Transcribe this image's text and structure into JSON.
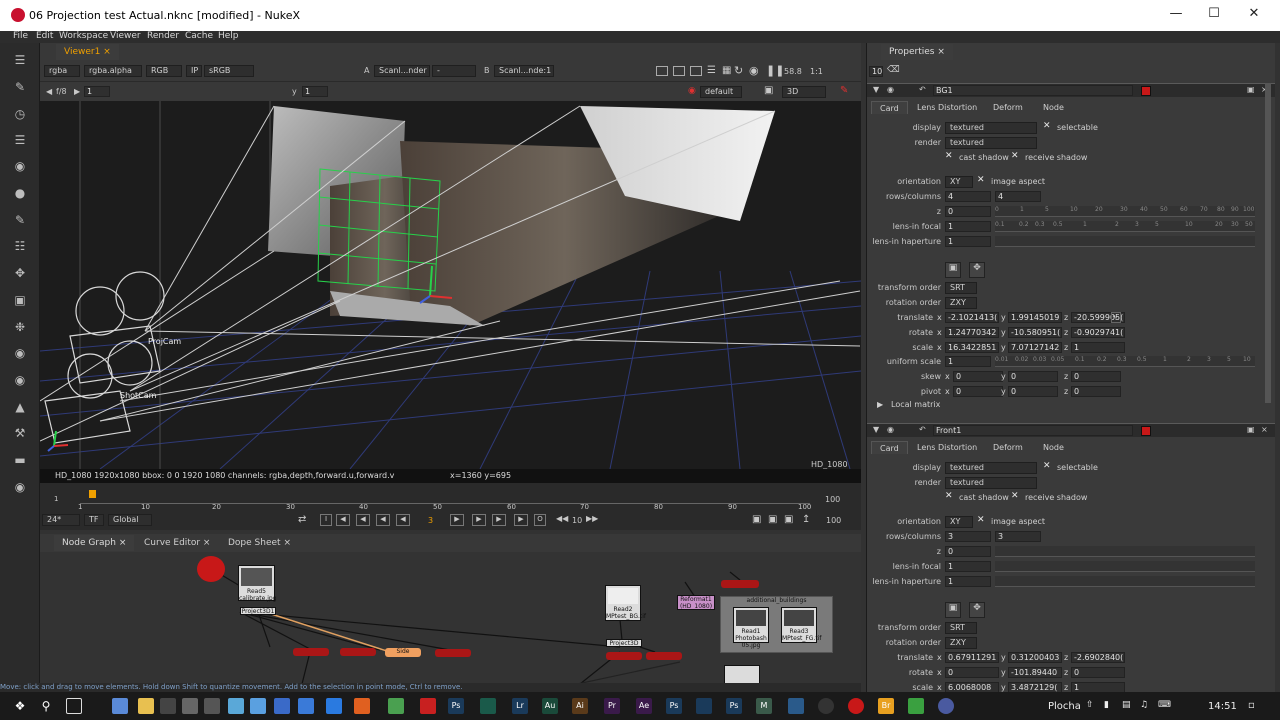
{
  "window": {
    "title": "06 Projection test Actual.nknc [modified] - NukeX"
  },
  "menu": [
    "File",
    "Edit",
    "Workspace",
    "Viewer",
    "Render",
    "Cache",
    "Help"
  ],
  "viewer": {
    "tab_label": "Viewer1",
    "channels": "rgba",
    "alpha": "rgba.alpha",
    "colorspace": "RGB",
    "ip_label": "IP",
    "lut": "sRGB",
    "input_a_label": "A",
    "input_a": "Scanl...nder",
    "input_a_op": "-",
    "input_b_label": "B",
    "input_b": "Scanl...nde:1",
    "gain": "58.8",
    "zoom": "1:1",
    "frame_label": "f/8",
    "frame_val": "1",
    "y_label": "y",
    "y_val": "1",
    "camera": "default",
    "view_mode": "3D",
    "label_projcam": "ProjCam",
    "label_shotcam": "ShotCam",
    "format_badge": "HD_1080",
    "info_text": "HD_1080 1920x1080  bbox: 0 0 1920 1080 channels: rgba,depth,forward.u,forward.v",
    "coords_text": "x=1360 y=695"
  },
  "timeline": {
    "ticks": [
      "1",
      "10",
      "20",
      "30",
      "40",
      "50",
      "60",
      "70",
      "80",
      "90",
      "100"
    ],
    "start": "1",
    "end": "100",
    "end_right": "100",
    "fps": "24*",
    "tf": "TF",
    "scope": "Global",
    "current_frame": "3",
    "step": "10",
    "out_frame": "100"
  },
  "bottom_tabs": [
    "Node Graph",
    "Curve Editor",
    "Dope Sheet"
  ],
  "nodes": {
    "read5": "Read5",
    "read5_file": "calibrate.jpg",
    "project3d1": "Project3D1",
    "side": "Side",
    "read2": "Read2",
    "read2_file": "MPtest_BG.tif",
    "project3d": "Project3D",
    "reformat": "Reformat1",
    "reformat_sub": "(HD_1080)",
    "backdrop": "additional_buildings",
    "read1": "Read1",
    "read1_file": "Photobash 05.jpg",
    "read3": "Read3",
    "read3_file": "MPtest_FG.tif"
  },
  "status_text": "Move: click and drag to move elements. Hold down Shift to quantize movement. Add to the selection in point mode, Ctrl to remove.",
  "properties": {
    "tab_label": "Properties",
    "max_panels": "10",
    "panels": [
      {
        "name": "BG1",
        "tabs": [
          "Card",
          "Lens Distortion",
          "Deform",
          "Node"
        ],
        "display_label": "display",
        "display": "textured",
        "selectable": "selectable",
        "render_label": "render",
        "render": "textured",
        "cast_shadow": "cast shadow",
        "receive_shadow": "receive shadow",
        "orientation_label": "orientation",
        "orientation": "XY",
        "image_aspect": "image aspect",
        "rows_label": "rows/columns",
        "rows": "4",
        "columns": "4",
        "z_label": "z",
        "z": "0",
        "focal_label": "lens-in focal",
        "focal": "1",
        "haperture_label": "lens-in haperture",
        "haperture": "1",
        "transform_order_label": "transform order",
        "transform_order": "SRT",
        "rotation_order_label": "rotation order",
        "rotation_order": "ZXY",
        "translate_label": "translate",
        "translate": [
          "-2.1021413(",
          "1.99145019",
          "-20.599905("
        ],
        "rotate_label": "rotate",
        "rotate": [
          "1.24770342",
          "-10.580951(",
          "-0.9029741("
        ],
        "scale_label": "scale",
        "scale": [
          "16.3422851",
          "7.07127142",
          "1"
        ],
        "uniform_scale_label": "uniform scale",
        "uniform_scale": "1",
        "skew_label": "skew",
        "skew": [
          "0",
          "0",
          "0"
        ],
        "pivot_label": "pivot",
        "pivot": [
          "0",
          "0",
          "0"
        ],
        "local_matrix": "Local matrix"
      },
      {
        "name": "Front1",
        "tabs": [
          "Card",
          "Lens Distortion",
          "Deform",
          "Node"
        ],
        "display_label": "display",
        "display": "textured",
        "selectable": "selectable",
        "render_label": "render",
        "render": "textured",
        "cast_shadow": "cast shadow",
        "receive_shadow": "receive shadow",
        "orientation_label": "orientation",
        "orientation": "XY",
        "image_aspect": "image aspect",
        "rows_label": "rows/columns",
        "rows": "3",
        "columns": "3",
        "z_label": "z",
        "z": "0",
        "focal_label": "lens-in focal",
        "focal": "1",
        "haperture_label": "lens-in haperture",
        "haperture": "1",
        "transform_order_label": "transform order",
        "transform_order": "SRT",
        "rotation_order_label": "rotation order",
        "rotation_order": "ZXY",
        "translate_label": "translate",
        "translate": [
          "0.67911291",
          "0.31200403",
          "-2.6902840("
        ],
        "rotate_label": "rotate",
        "rotate": [
          "0",
          "-101.89440",
          "0"
        ],
        "scale_label": "scale",
        "scale": [
          "6.0068008",
          "3.4872129(",
          "1"
        ]
      }
    ],
    "axis_x": "x",
    "axis_y": "y",
    "axis_z": "z",
    "z_ticks": [
      "0",
      "1",
      "5",
      "10",
      "20",
      "30",
      "40",
      "50",
      "60",
      "70",
      "80",
      "90",
      "100"
    ],
    "focal_ticks": [
      "0.1",
      "0.2",
      "0.3",
      "0.5",
      "1",
      "2",
      "3",
      "5",
      "10",
      "20",
      "30",
      "50"
    ],
    "uscale_ticks": [
      "0.01",
      "0.02",
      "0.03",
      "0.05",
      "0.1",
      "0.2",
      "0.3",
      "0.5",
      "1",
      "2",
      "3",
      "5",
      "10"
    ]
  },
  "taskbar": {
    "label": "Plocha",
    "clock": "14:51",
    "apps": [
      "Ps",
      "Lr",
      "Au",
      "Ai",
      "Pr",
      "Ae",
      "Ps",
      "Ps",
      "M",
      "Br"
    ]
  }
}
